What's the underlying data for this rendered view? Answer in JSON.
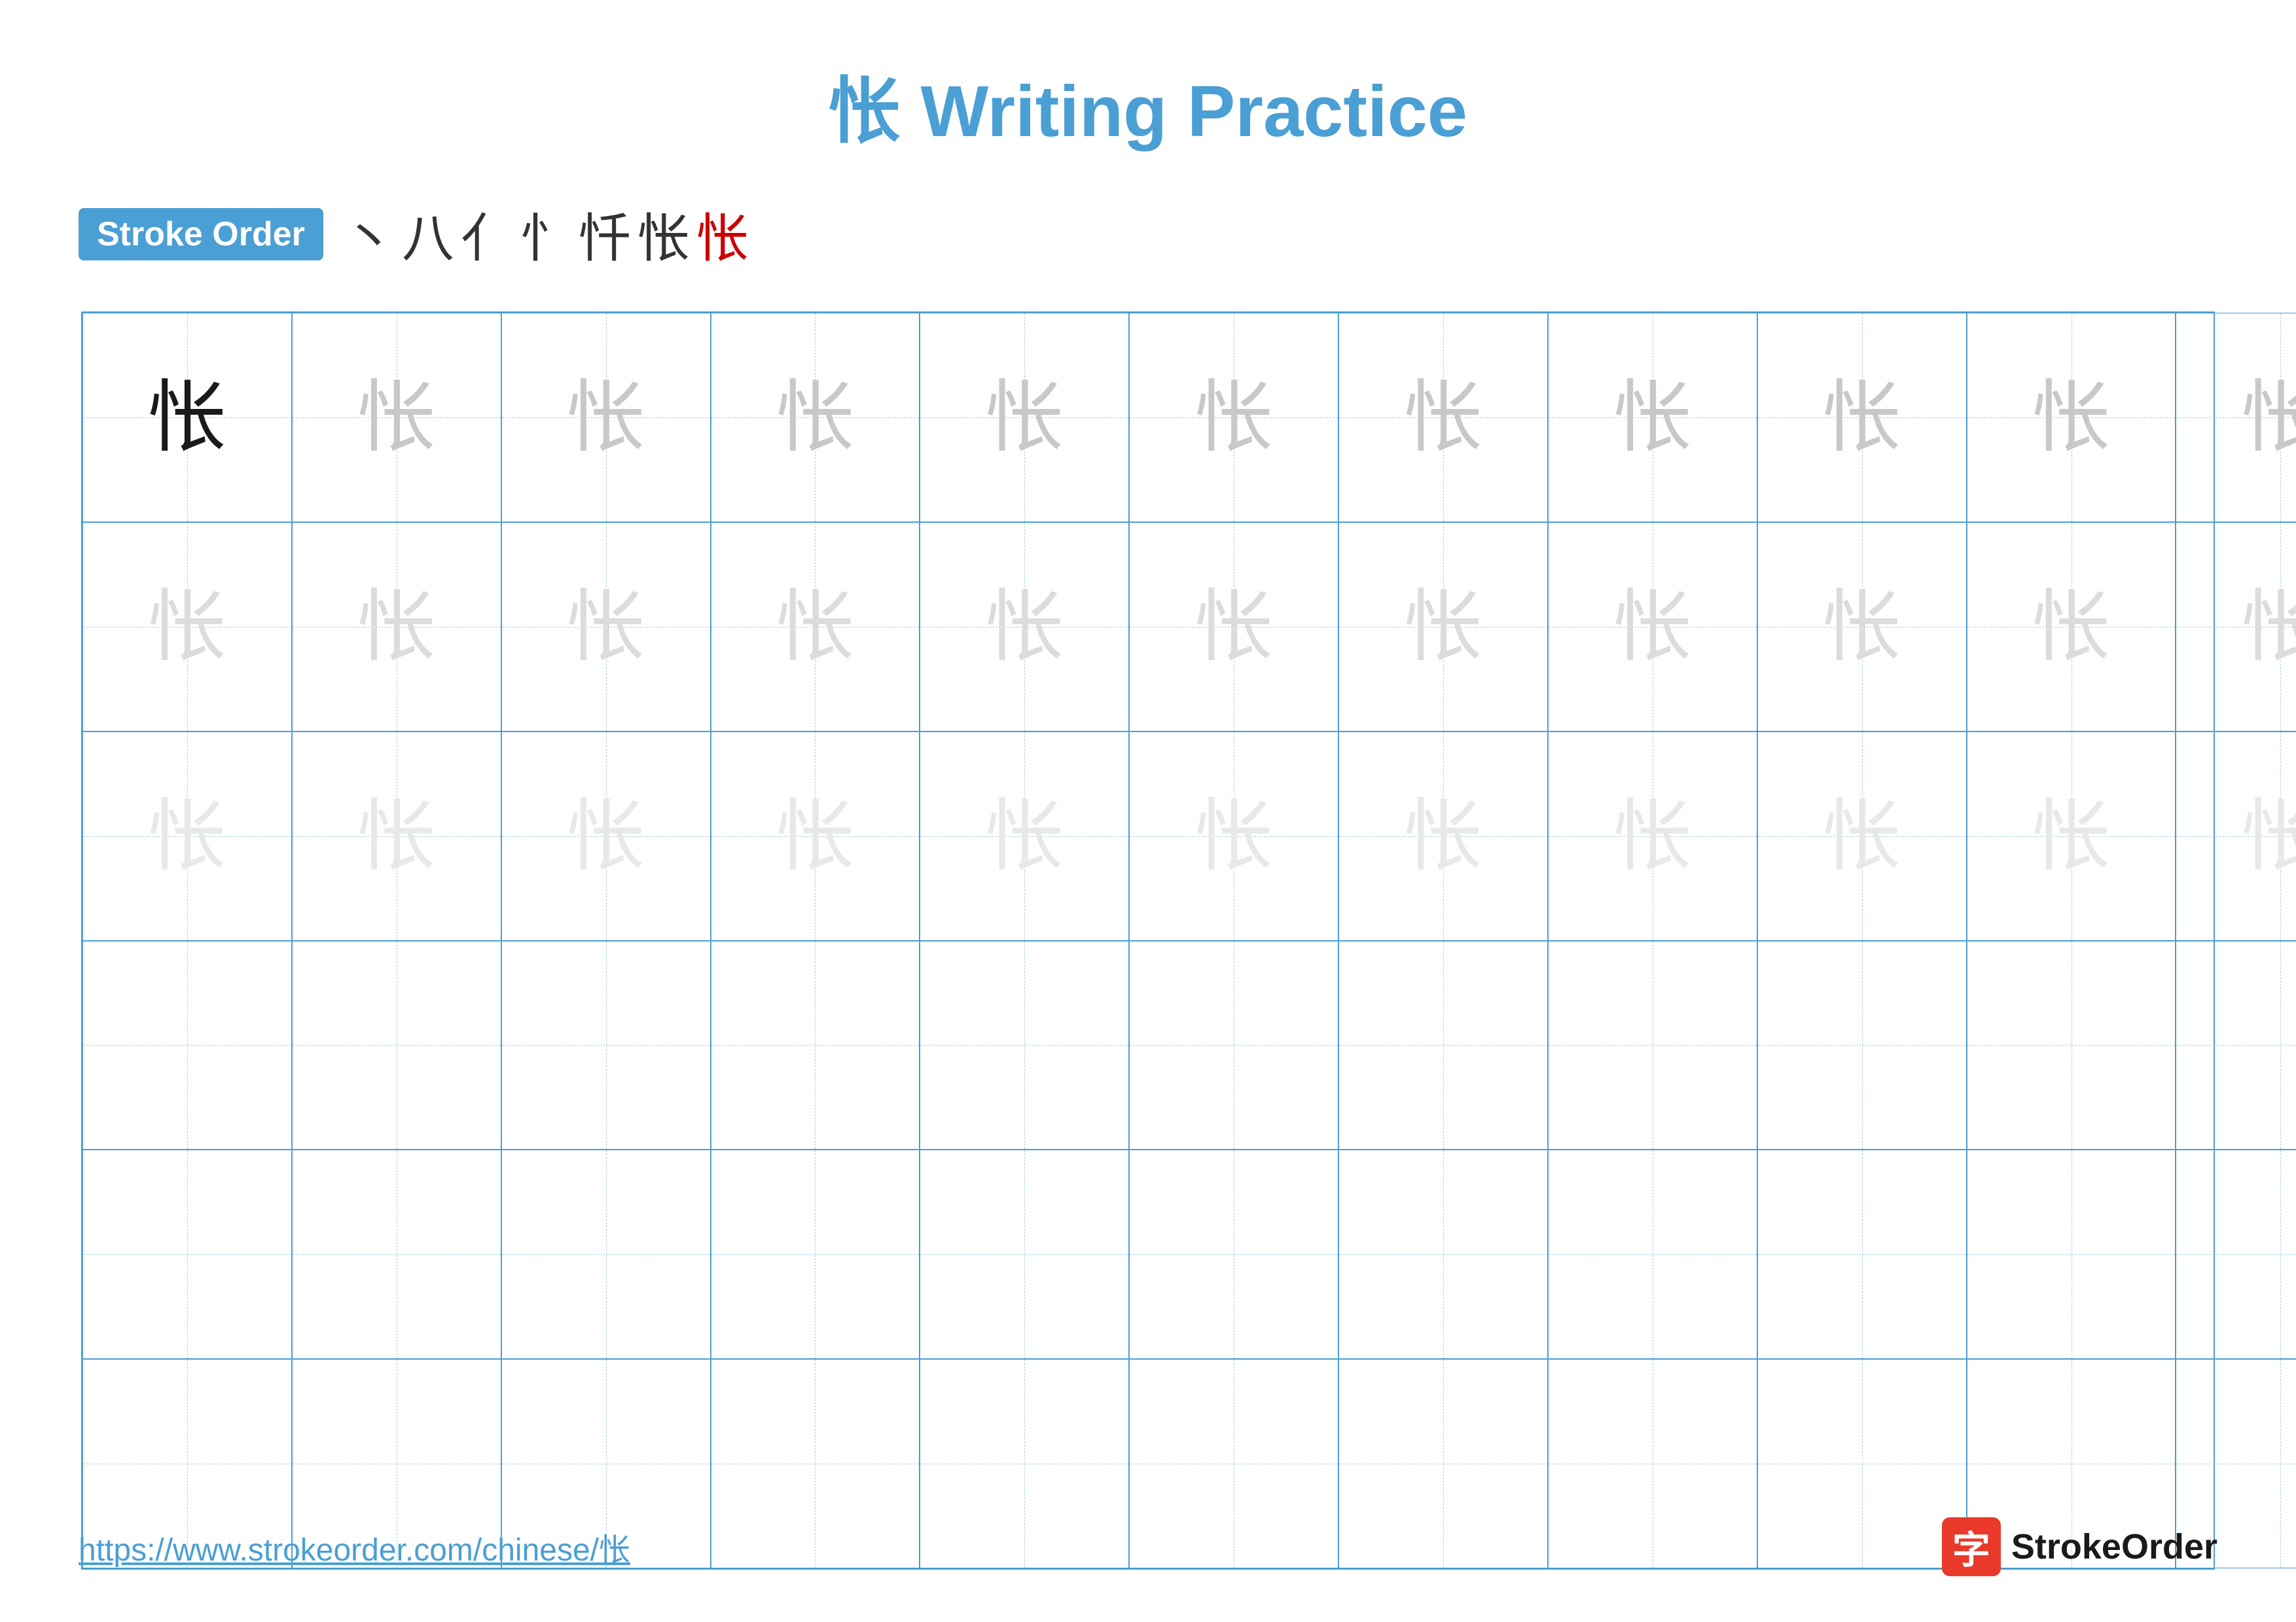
{
  "title": "怅 Writing Practice",
  "stroke_order_badge": "Stroke Order",
  "stroke_sequence": [
    "丶",
    "八",
    "亻",
    "忄",
    "忏",
    "怅",
    "怅"
  ],
  "character": "怅",
  "url": "https://www.strokeorder.com/chinese/怅",
  "logo_text": "StrokeOrder",
  "logo_icon": "字",
  "grid": {
    "cols": 13,
    "rows": 6
  }
}
